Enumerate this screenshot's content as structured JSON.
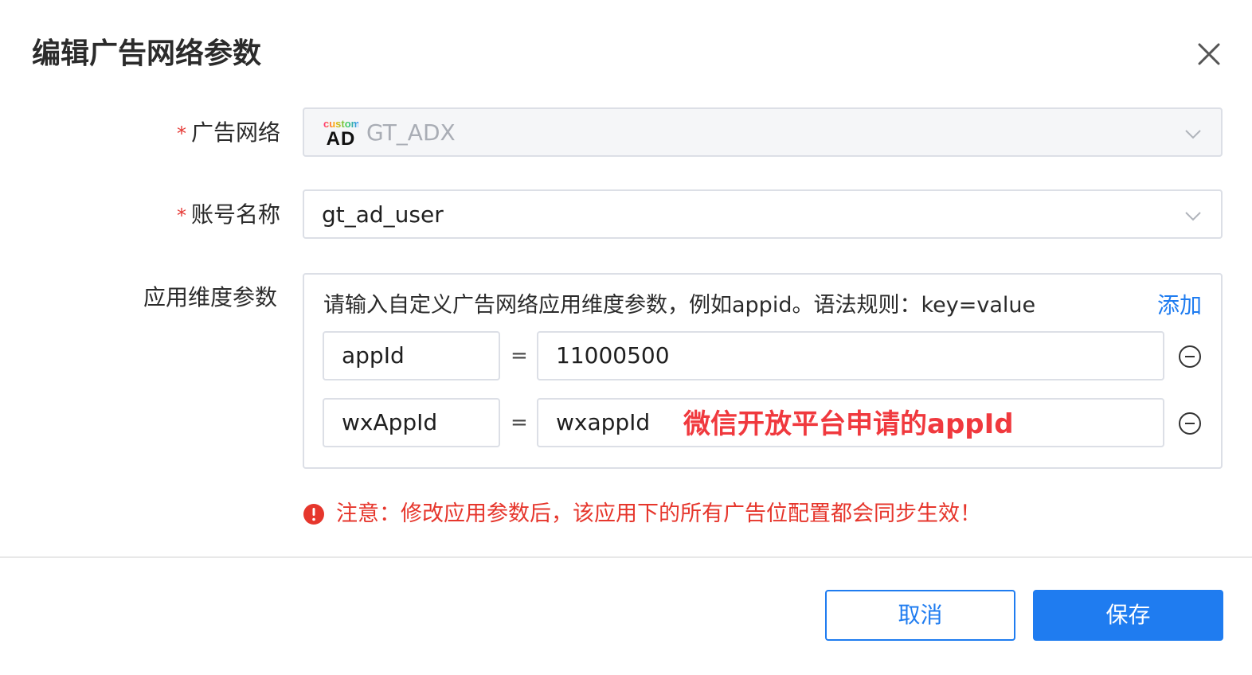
{
  "dialog": {
    "title": "编辑广告网络参数"
  },
  "form": {
    "ad_network": {
      "required_mark": "*",
      "label": "广告网络",
      "logo_top": "custom",
      "logo_bottom": "AD",
      "value": "GT_ADX",
      "disabled": true
    },
    "account_name": {
      "required_mark": "*",
      "label": "账号名称",
      "value": "gt_ad_user"
    },
    "app_params": {
      "label": "应用维度参数",
      "hint": "请输入自定义广告网络应用维度参数，例如appid。语法规则：key=value",
      "add_label": "添加",
      "rows": [
        {
          "key": "appId",
          "eq": "=",
          "value": "11000500"
        },
        {
          "key": "wxAppId",
          "eq": "=",
          "value": "wxappId"
        }
      ],
      "annotation": "微信开放平台申请的appId"
    },
    "notice": "注意：修改应用参数后，该应用下的所有广告位配置都会同步生效！"
  },
  "footer": {
    "cancel_label": "取消",
    "save_label": "保存"
  },
  "colors": {
    "primary": "#1f7cf0",
    "danger": "#e6362c",
    "border": "#dcdfe6"
  },
  "icons": {
    "close": "close-icon",
    "chevron": "chevron-down-icon",
    "remove": "minus-circle-icon",
    "warning": "exclamation-circle-icon"
  }
}
